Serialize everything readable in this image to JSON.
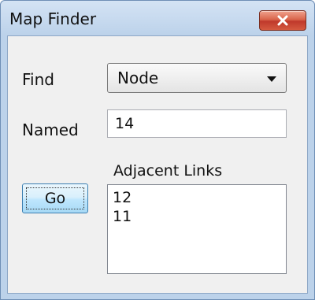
{
  "window": {
    "title": "Map Finder"
  },
  "form": {
    "find_label": "Find",
    "find_value": "Node",
    "named_label": "Named",
    "named_value": "14",
    "adjacent_label": "Adjacent Links",
    "adjacent_items": [
      "12",
      "11"
    ],
    "go_label": "Go"
  },
  "icons": {
    "close": "close-icon",
    "dropdown": "chevron-down-icon"
  }
}
